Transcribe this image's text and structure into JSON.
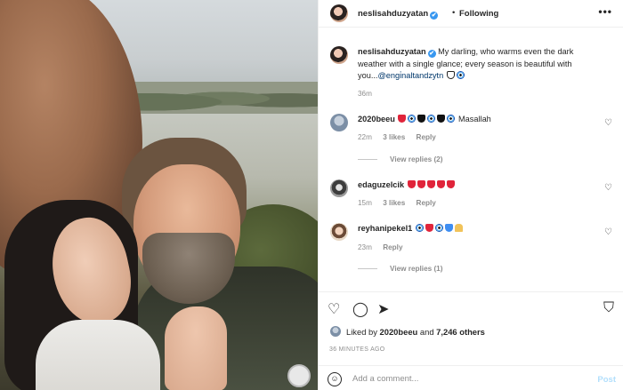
{
  "post": {
    "username": "neslisahduzyatan",
    "verified_mark": "✔",
    "dot": "•",
    "follow_label": "Following",
    "more_label": "•••",
    "caption_text": "My darling, who warms even the dark weather with a single glance; every season is beautiful with you...",
    "caption_mention": "@engi̇naltandzytn",
    "caption_time": "36m"
  },
  "comments": [
    {
      "username": "2020beeu",
      "text": "Masallah",
      "time": "22m",
      "likes": "3 likes",
      "reply": "Reply",
      "view_replies": "View replies (2)"
    },
    {
      "username": "edaguzelcik",
      "text": "",
      "time": "15m",
      "likes": "3 likes",
      "reply": "Reply",
      "view_replies": ""
    },
    {
      "username": "reyhanipekel1",
      "text": "",
      "time": "23m",
      "likes": "",
      "reply": "Reply",
      "view_replies": "View replies (1)"
    }
  ],
  "likes": {
    "prefix": "Liked by",
    "user": "2020beeu",
    "and": "and",
    "count": "7,246 others"
  },
  "timestamp": "36 MINUTES AGO",
  "comment_box": {
    "placeholder": "Add a comment...",
    "post_label": "Post"
  },
  "icons": {
    "heart": "♡",
    "comment": "◯",
    "share": "➤",
    "save": "⛉",
    "smile": "☺"
  },
  "colors": {
    "link": "#00376b",
    "verified": "#3897f0",
    "muted": "#8e8e8e",
    "post_disabled": "#b2dffc"
  }
}
